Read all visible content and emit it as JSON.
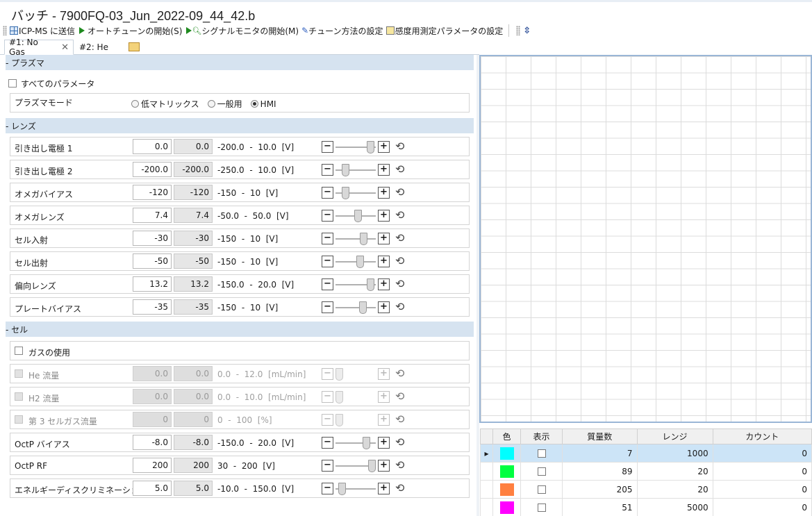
{
  "window": {
    "title": "バッチ - 7900FQ-03_Jun_2022-09_44_42.b"
  },
  "toolbar": {
    "send_icp": "ICP-MS に送信",
    "autotune": "オートチューンの開始(S)",
    "signal_monitor": "シグナルモニタの開始(M)",
    "tune_method": "チューン方法の設定",
    "sensitivity": "感度用測定パラメータの設定"
  },
  "tabs": [
    {
      "label": "#1: No Gas"
    },
    {
      "label": "#2: He"
    }
  ],
  "sections": {
    "plasma": "-  プラズマ",
    "lens": "-  レンズ",
    "cell": "-  セル"
  },
  "plasma": {
    "all_params": "すべてのパラメータ",
    "mode_label": "プラズマモード",
    "modes": [
      "低マトリックス",
      "一般用",
      "HMI"
    ],
    "selected_mode": "HMI"
  },
  "lens_rows": [
    {
      "label": "引き出し電極 1",
      "v1": "0.0",
      "v2": "0.0",
      "range": "-200.0  -  10.0  [V]",
      "level": 0.95
    },
    {
      "label": "引き出し電極 2",
      "v1": "-200.0",
      "v2": "-200.0",
      "range": "-250.0  -  10.0  [V]",
      "level": 0.19
    },
    {
      "label": "オメガバイアス",
      "v1": "-120",
      "v2": "-120",
      "range": "-150  -  10  [V]",
      "level": 0.19
    },
    {
      "label": "オメガレンズ",
      "v1": "7.4",
      "v2": "7.4",
      "range": "-50.0  -  50.0  [V]",
      "level": 0.57
    },
    {
      "label": "セル入射",
      "v1": "-30",
      "v2": "-30",
      "range": "-150  -  10  [V]",
      "level": 0.75
    },
    {
      "label": "セル出射",
      "v1": "-50",
      "v2": "-50",
      "range": "-150  -  10  [V]",
      "level": 0.63
    },
    {
      "label": "偏向レンズ",
      "v1": "13.2",
      "v2": "13.2",
      "range": "-150.0  -  20.0  [V]",
      "level": 0.96
    },
    {
      "label": "プレートバイアス",
      "v1": "-35",
      "v2": "-35",
      "range": "-150  -  10  [V]",
      "level": 0.72
    }
  ],
  "cell": {
    "use_gas": "ガスの使用",
    "gas_rows": [
      {
        "label": "He 流量",
        "v1": "0.0",
        "v2": "0.0",
        "range": "0.0  -  12.0  [mL/min]"
      },
      {
        "label": "H2 流量",
        "v1": "0.0",
        "v2": "0.0",
        "range": "0.0  -  10.0  [mL/min]"
      },
      {
        "label": "第 3 セルガス流量",
        "v1": "0",
        "v2": "0",
        "range": "0  -  100  [%]"
      }
    ],
    "rows": [
      {
        "label": "OctP バイアス",
        "v1": "-8.0",
        "v2": "-8.0",
        "range": "-150.0  -  20.0  [V]",
        "level": 0.84
      },
      {
        "label": "OctP RF",
        "v1": "200",
        "v2": "200",
        "range": "30  -  200  [V]",
        "level": 1.0
      },
      {
        "label": "エネルギーディスクリミネーション",
        "v1": "5.0",
        "v2": "5.0",
        "range": "-10.0  -  150.0  [V]",
        "level": 0.09
      }
    ]
  },
  "table": {
    "headers": [
      "色",
      "表示",
      "質量数",
      "レンジ",
      "カウント"
    ],
    "rows": [
      {
        "color": "#00ffff",
        "mass": "7",
        "range": "1000",
        "count": "0"
      },
      {
        "color": "#00ff40",
        "mass": "89",
        "range": "20",
        "count": "0"
      },
      {
        "color": "#ff8040",
        "mass": "205",
        "range": "20",
        "count": "0"
      },
      {
        "color": "#ff00ff",
        "mass": "51",
        "range": "5000",
        "count": "0"
      }
    ]
  }
}
